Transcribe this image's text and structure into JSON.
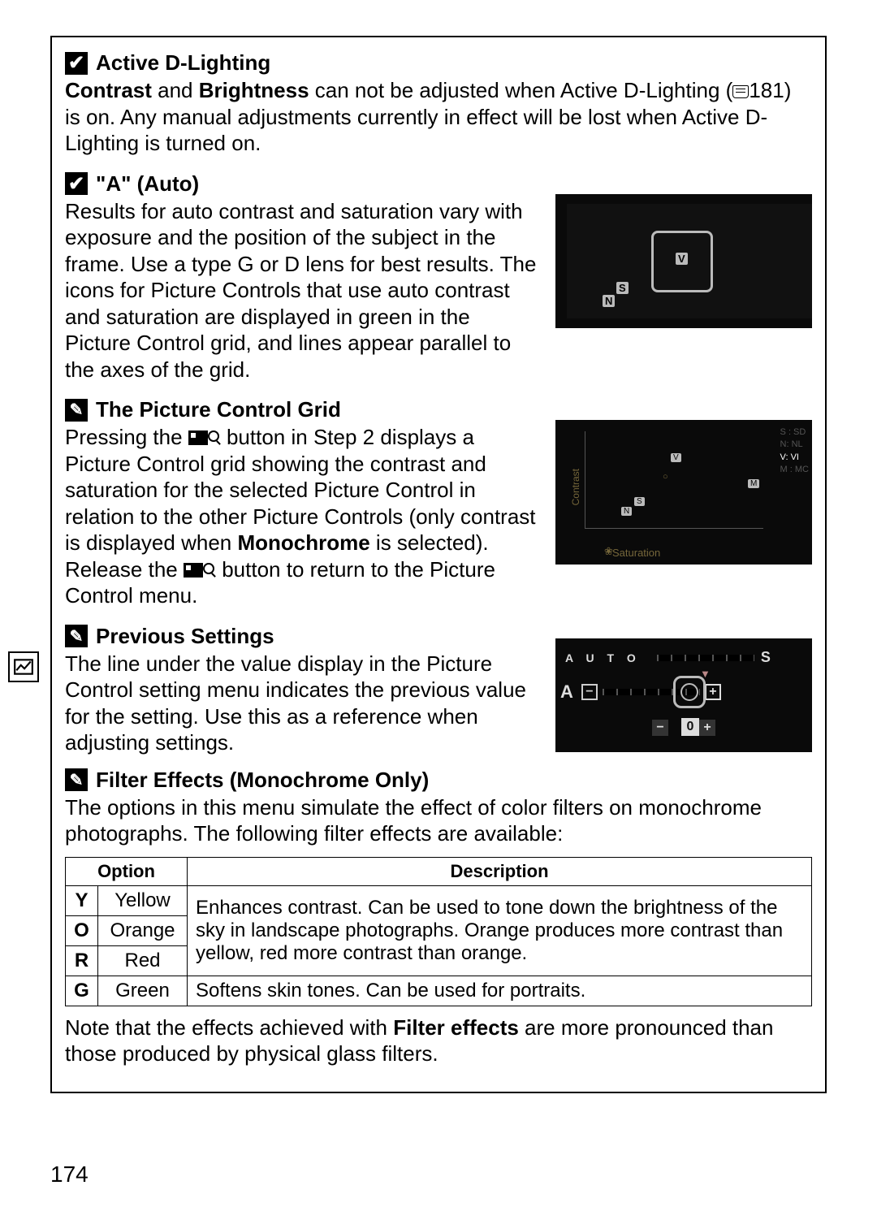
{
  "page_number": "174",
  "sections": {
    "s1": {
      "title": "Active D-Lighting",
      "body_pre": " and ",
      "bold1": "Contrast",
      "bold2": "Brightness",
      "body_post": " can not be adjusted when Active D-Lighting (",
      "pageref": "181",
      "body_post2": ") is on. Any manual adjustments currently in effect will be lost when Active D-Lighting is turned on."
    },
    "s2": {
      "title": "\"A\" (Auto)",
      "body": "Results for auto contrast and saturation vary with exposure and the position of the subject in the frame.  Use a type G or D lens for best results.  The icons for Picture Controls that use auto contrast and saturation are displayed in green in the Picture Control grid, and lines appear parallel to the axes of the grid."
    },
    "s3": {
      "title": "The Picture Control Grid",
      "body_a": "Pressing the ",
      "body_b": " button in Step 2 displays a Picture Control grid showing the contrast and saturation for the selected Picture Control in relation to the other Picture Controls (only contrast is displayed when ",
      "bold": "Monochrome",
      "body_c": " is selected).  Release the ",
      "body_d": " button to return to the Picture Control menu."
    },
    "s4": {
      "title": "Previous Settings",
      "body": "The line under the value display in the Picture Control setting menu indicates the previous value for the setting.  Use this as a reference when adjusting settings."
    },
    "s5": {
      "title": "Filter Effects (Monochrome Only)",
      "body": "The options in this menu simulate the effect of color filters on monochrome photographs.  The following filter effects are available:",
      "note_a": "Note that the effects achieved with ",
      "note_bold": "Filter effects",
      "note_b": " are more pronounced than those produced by physical glass filters."
    }
  },
  "table": {
    "headers": {
      "opt": "Option",
      "desc": "Description"
    },
    "rows": [
      {
        "code": "Y",
        "name": "Yellow"
      },
      {
        "code": "O",
        "name": "Orange"
      },
      {
        "code": "R",
        "name": "Red"
      },
      {
        "code": "G",
        "name": "Green"
      }
    ],
    "desc_merged": "Enhances contrast.  Can be used to tone down the brightness of the sky in landscape photographs.  Orange produces more contrast than yellow, red more contrast than orange.",
    "desc_green": "Softens skin tones.  Can be used for portraits."
  },
  "camshots": {
    "c1": {
      "V": "V",
      "S": "S",
      "N": "N"
    },
    "c2": {
      "ylabel": "Contrast",
      "xlabel": "Saturation",
      "legend": [
        "S : SD",
        "N: NL",
        "V: VI",
        "M : MC"
      ],
      "pts": {
        "V": "V",
        "S": "S",
        "N": "N",
        "M": "M"
      }
    },
    "c3": {
      "letter": "A",
      "zero": "0",
      "autos": "A U T O",
      "plus": "+",
      "minus": "−"
    }
  }
}
